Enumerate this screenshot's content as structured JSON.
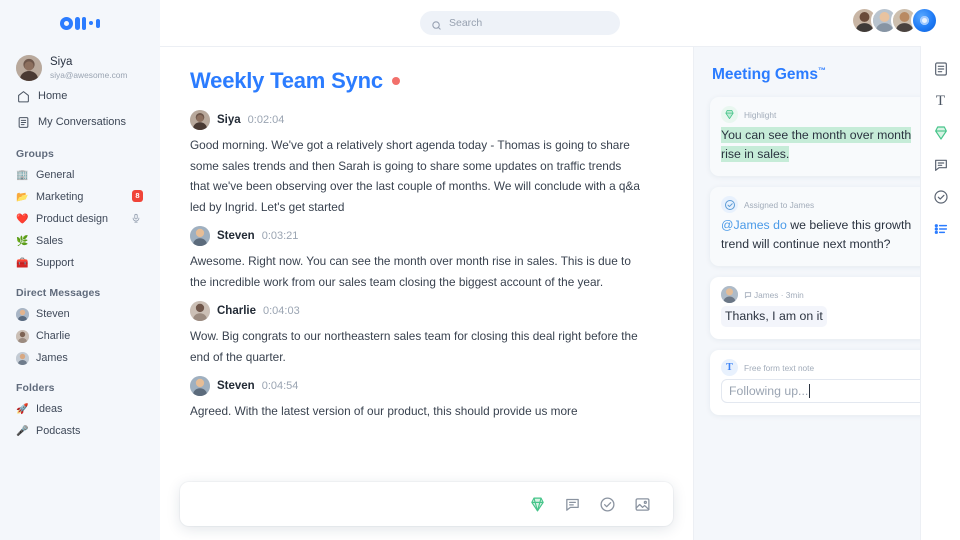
{
  "brand": {
    "logo_name": "otter-logo",
    "accent": "#2b7cff"
  },
  "sidebar": {
    "user": {
      "name": "Siya",
      "email": "siya@awesome.com"
    },
    "nav": [
      {
        "label": "Home",
        "icon": "home-icon"
      },
      {
        "label": "My Conversations",
        "icon": "conversations-icon"
      }
    ],
    "groups_title": "Groups",
    "groups": [
      {
        "label": "General",
        "emoji": "🏢",
        "badge": ""
      },
      {
        "label": "Marketing",
        "emoji": "📂",
        "badge": "8"
      },
      {
        "label": "Product design",
        "emoji": "❤️",
        "badge": "",
        "mic": true
      },
      {
        "label": "Sales",
        "emoji": "🌿",
        "badge": ""
      },
      {
        "label": "Support",
        "emoji": "🧰",
        "badge": ""
      }
    ],
    "dm_title": "Direct Messages",
    "dms": [
      {
        "label": "Steven"
      },
      {
        "label": "Charlie"
      },
      {
        "label": "James"
      }
    ],
    "folders_title": "Folders",
    "folders": [
      {
        "label": "Ideas",
        "emoji": "🚀"
      },
      {
        "label": "Podcasts",
        "emoji": "🎤"
      }
    ]
  },
  "topbar": {
    "search_placeholder": "Search",
    "avatars": [
      "member-1",
      "member-2",
      "member-3"
    ],
    "record_button": "record-button"
  },
  "main": {
    "title": "Weekly Team Sync",
    "recording_indicator": "recording-dot",
    "messages": [
      {
        "speaker": "Siya",
        "time": "0:02:04",
        "text": "Good morning. We've got a relatively short agenda today - Thomas is going to share some sales trends and then Sarah is going to share some updates on traffic trends that we've been observing over the last couple of months. We will conclude with a q&a led by Ingrid. Let's get started"
      },
      {
        "speaker": "Steven",
        "time": "0:03:21",
        "text": "Awesome. Right now. You can see the month over month rise in sales. This is due to the incredible work from our sales team closing the biggest account of the year."
      },
      {
        "speaker": "Charlie",
        "time": "0:04:03",
        "text": "Wow. Big congrats to our northeastern sales team for closing this deal right before the end of the quarter."
      },
      {
        "speaker": "Steven",
        "time": "0:04:54",
        "text": "Agreed. With the latest version of our product, this should provide us more"
      }
    ],
    "composer_tools": [
      {
        "name": "highlight-gem-icon"
      },
      {
        "name": "comment-icon"
      },
      {
        "name": "task-check-icon"
      },
      {
        "name": "image-icon"
      }
    ]
  },
  "gems": {
    "title": "Meeting Gems",
    "title_tm": "™",
    "cards": [
      {
        "type": "highlight",
        "icon": "highlight-gem-icon",
        "label": "Highlight",
        "text": "You can see the month over month rise in sales."
      },
      {
        "type": "action",
        "icon": "task-check-icon",
        "label": "Assigned to James",
        "mention": "@James do",
        "text": " we believe this growth trend will continue next month?"
      },
      {
        "type": "reply",
        "icon": "comment-icon",
        "label": "James · 3min",
        "text": "Thanks, I am on it"
      },
      {
        "type": "note",
        "icon": "text-note-icon",
        "label": "Free form text note",
        "text": "Following up..."
      }
    ]
  },
  "rail": [
    {
      "name": "notes-icon"
    },
    {
      "name": "text-icon",
      "glyph": "T"
    },
    {
      "name": "highlight-gem-icon"
    },
    {
      "name": "comment-icon"
    },
    {
      "name": "task-check-icon"
    },
    {
      "name": "outline-list-icon"
    }
  ]
}
